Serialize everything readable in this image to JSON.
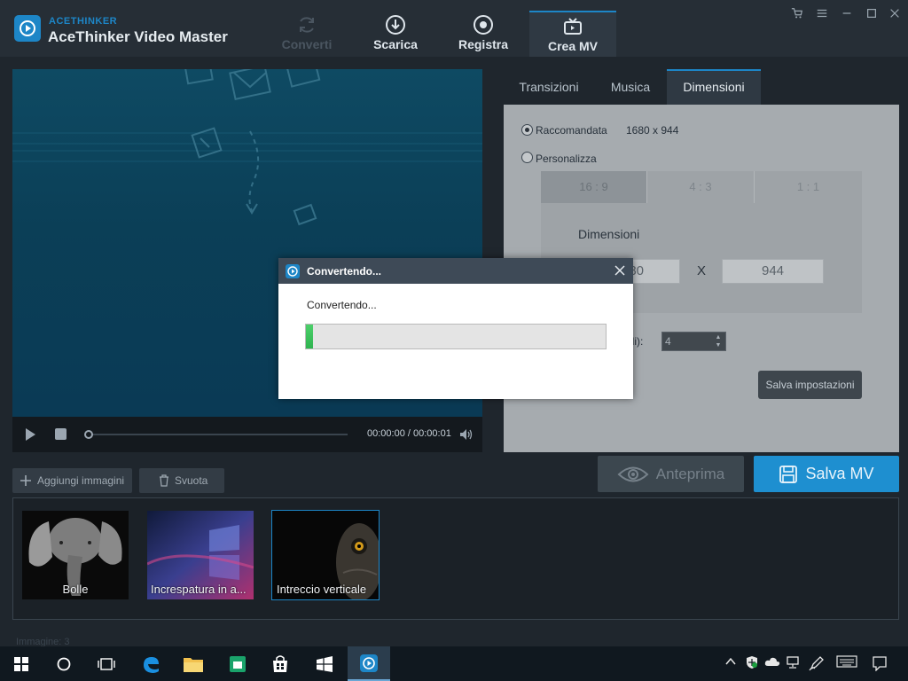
{
  "app": {
    "brand_small": "ACETHINKER",
    "title": "AceThinker Video Master"
  },
  "main_tabs": [
    {
      "label": "Converti",
      "icon": "refresh-icon",
      "state": "disabled"
    },
    {
      "label": "Scarica",
      "icon": "download-icon",
      "state": "normal"
    },
    {
      "label": "Registra",
      "icon": "record-icon",
      "state": "normal"
    },
    {
      "label": "Crea MV",
      "icon": "tv-icon",
      "state": "active"
    }
  ],
  "window_controls": [
    "cart-icon",
    "menu-icon",
    "minimize-icon",
    "maximize-icon",
    "close-icon"
  ],
  "player": {
    "time": "00:00:00 / 00:00:01",
    "progress": 0
  },
  "sub_tabs": [
    {
      "label": "Transizioni"
    },
    {
      "label": "Musica"
    },
    {
      "label": "Dimensioni"
    }
  ],
  "dimensions": {
    "recommended_label": "Raccomandata",
    "recommended_value": "1680 x 944",
    "custom_label": "Personalizza",
    "ratios": [
      "16 : 9",
      "4 : 3",
      "1 : 1"
    ],
    "selected_ratio": "16 : 9",
    "size_label": "Dimensioni",
    "width_value": "1680",
    "width_visible": "80",
    "x_symbol": "X",
    "height_value": "944",
    "duration_label_visible": "ndi):",
    "duration_value": "4",
    "save_settings": "Salva impostazioni"
  },
  "actions": {
    "preview": "Anteprima",
    "save_mv": "Salva MV"
  },
  "toolbar": {
    "add_images": "Aggiungi immagini",
    "clear": "Svuota"
  },
  "thumbnails": [
    {
      "label": "Bolle",
      "selected": false
    },
    {
      "label": "Increspatura in a...",
      "selected": false
    },
    {
      "label": "Intreccio verticale",
      "selected": true
    }
  ],
  "image_count": "Immagine: 3",
  "dialog": {
    "title": "Convertendo...",
    "message": "Convertendo...",
    "progress_percent": 2.5
  },
  "taskbar": {
    "items": [
      "windows-start-icon",
      "search-circle-icon",
      "task-view-icon",
      "edge-icon",
      "file-explorer-icon",
      "store-bag-icon",
      "store-icon",
      "media-player-icon",
      "acethinker-icon"
    ],
    "tray": [
      "chevron-up-icon",
      "defender-icon",
      "onedrive-icon",
      "network-icon",
      "pen-icon",
      "keyboard-icon",
      "notification-icon"
    ]
  },
  "colors": {
    "accent": "#1d86c7",
    "save_button": "#1e8fd0",
    "progress_green": "#2fb350"
  }
}
